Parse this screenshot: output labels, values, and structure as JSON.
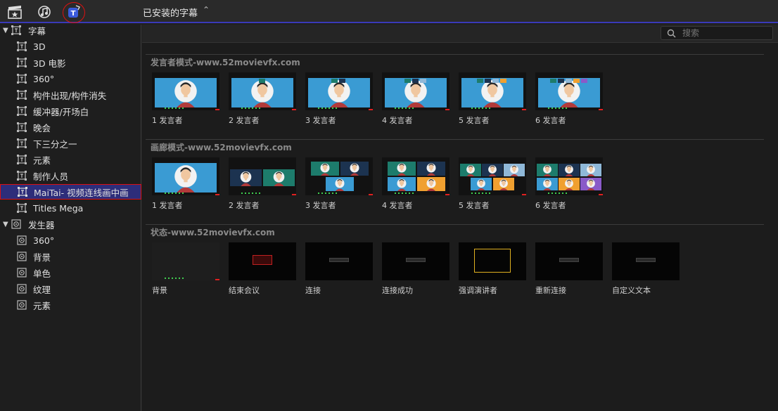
{
  "toolbar": {
    "icons": [
      "clapper-star-icon",
      "music-note-icon",
      "titles-icon"
    ],
    "library_title": "已安装的字幕",
    "library_chevron": "⌃⌄"
  },
  "sidebar": {
    "categories": [
      {
        "label": "字幕",
        "items": [
          "3D",
          "3D 电影",
          "360°",
          "构件出现/构件消失",
          "缓冲器/开场白",
          "晚会",
          "下三分之一",
          "元素",
          "制作人员",
          "MaiTai- 视频连线画中画",
          "Titles Mega"
        ]
      },
      {
        "label": "发生器",
        "items": [
          "360°",
          "背景",
          "单色",
          "纹理",
          "元素"
        ]
      }
    ],
    "selected": "MaiTai- 视频连线画中画"
  },
  "search": {
    "placeholder": "搜索"
  },
  "sections": [
    {
      "title": "发言者模式-www.52movievfx.com",
      "items": [
        "1 发言者",
        "2 发言者",
        "3 发言者",
        "4 发言者",
        "5 发言者",
        "6 发言者"
      ]
    },
    {
      "title": "画廊模式-www.52movievfx.com",
      "items": [
        "1 发言者",
        "2 发言者",
        "3 发言者",
        "4 发言者",
        "5 发言者",
        "6 发言者"
      ]
    },
    {
      "title": "状态-www.52movievfx.com",
      "items": [
        "背景",
        "结束会议",
        "连接",
        "连接成功",
        "强调演讲者",
        "重新连接",
        "自定义文本"
      ]
    }
  ],
  "colors": {
    "accent": "#3a3ab8",
    "selection_bg": "#2d2d7a",
    "highlight_ring": "#dd1111",
    "tile_blue": "#3a9bd3",
    "tile_teal": "#1d7c6c",
    "tile_orange": "#f0a030",
    "tile_purple": "#8a5ac8"
  }
}
